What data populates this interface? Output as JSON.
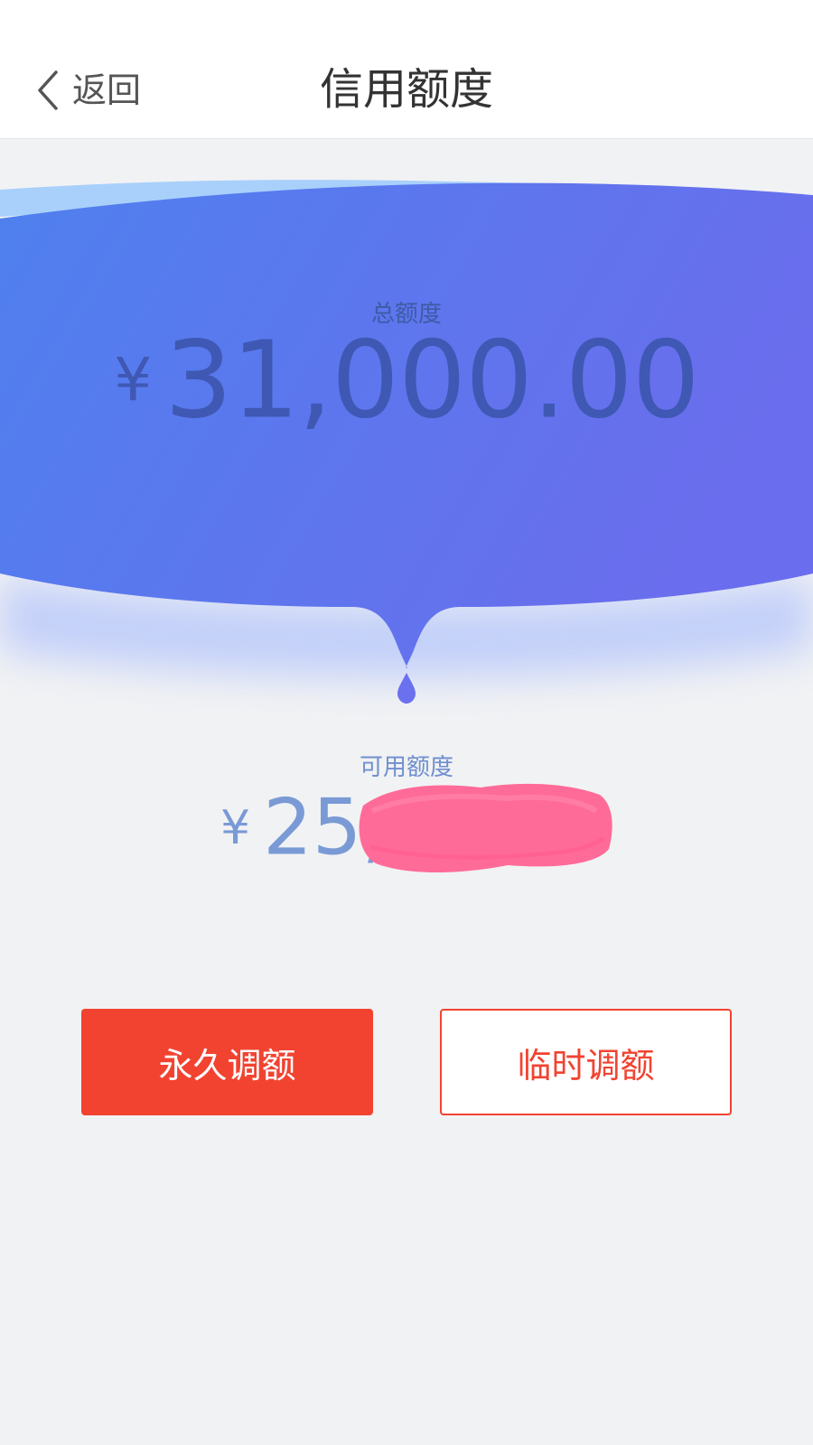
{
  "header": {
    "back_label": "返回",
    "title": "信用额度"
  },
  "credit": {
    "total_label": "总额度",
    "total_currency": "¥",
    "total_amount": "31,000.00",
    "available_label": "可用额度",
    "available_currency": "¥",
    "available_amount_visible": "25,"
  },
  "actions": {
    "permanent_label": "永久调额",
    "temporary_label": "临时调额"
  },
  "colors": {
    "accent_red": "#f24331",
    "hero_gradient_start": "#4f80ee",
    "hero_gradient_end": "#6a6ded",
    "amount_blue": "#3f58b3",
    "redaction_pink": "#ff6b98"
  },
  "icons": {
    "back": "chevron-left-icon"
  }
}
